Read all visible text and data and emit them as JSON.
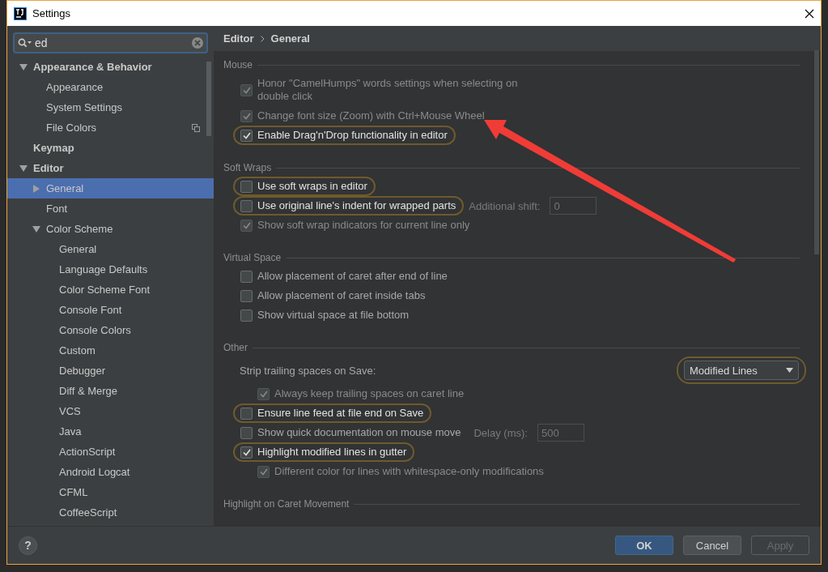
{
  "window": {
    "title": "Settings"
  },
  "sidebar": {
    "search": {
      "value": "ed"
    },
    "items": [
      {
        "label": "Appearance & Behavior",
        "expanded": true,
        "selected": false,
        "children": [
          {
            "label": "Appearance",
            "selected": false
          },
          {
            "label": "System Settings",
            "selected": false
          },
          {
            "label": "File Colors",
            "selected": false,
            "project_level": true
          }
        ]
      },
      {
        "label": "Keymap",
        "selected": false
      },
      {
        "label": "Editor",
        "expanded": true,
        "selected": false,
        "children": [
          {
            "label": "General",
            "expanded": false,
            "selected": true
          },
          {
            "label": "Font",
            "selected": false
          },
          {
            "label": "Color Scheme",
            "expanded": true,
            "selected": false,
            "children": [
              {
                "label": "General",
                "selected": false
              },
              {
                "label": "Language Defaults",
                "selected": false
              },
              {
                "label": "Color Scheme Font",
                "selected": false
              },
              {
                "label": "Console Font",
                "selected": false
              },
              {
                "label": "Console Colors",
                "selected": false
              },
              {
                "label": "Custom",
                "selected": false
              },
              {
                "label": "Debugger",
                "selected": false
              },
              {
                "label": "Diff & Merge",
                "selected": false
              },
              {
                "label": "VCS",
                "selected": false
              },
              {
                "label": "Java",
                "selected": false
              },
              {
                "label": "ActionScript",
                "selected": false
              },
              {
                "label": "Android Logcat",
                "selected": false
              },
              {
                "label": "CFML",
                "selected": false
              },
              {
                "label": "CoffeeScript",
                "selected": false
              }
            ]
          }
        ]
      }
    ]
  },
  "breadcrumb": [
    "Editor",
    "General"
  ],
  "sections": [
    {
      "title": "Mouse",
      "rows": [
        {
          "kind": "checkbox",
          "label": "Honor \"CamelHumps\" words settings when selecting on double click",
          "checked": true,
          "disabled": true,
          "highlighted": false
        },
        {
          "kind": "checkbox",
          "label": "Change font size (Zoom) with Ctrl+Mouse Wheel",
          "checked": true,
          "disabled": true,
          "highlighted": false
        },
        {
          "kind": "checkbox",
          "label": "Enable Drag'n'Drop functionality in editor",
          "checked": true,
          "disabled": false,
          "highlighted": true
        }
      ]
    },
    {
      "title": "Soft Wraps",
      "rows": [
        {
          "kind": "checkbox",
          "label": "Use soft wraps in editor",
          "checked": false,
          "disabled": false,
          "highlighted": true
        },
        {
          "kind": "checkbox",
          "label": "Use original line's indent for wrapped parts",
          "checked": false,
          "disabled": false,
          "highlighted": true,
          "field": {
            "label": "Additional shift:",
            "value": "0",
            "disabled": true
          }
        },
        {
          "kind": "checkbox",
          "label": "Show soft wrap indicators for current line only",
          "checked": true,
          "disabled": true,
          "highlighted": false
        }
      ]
    },
    {
      "title": "Virtual Space",
      "rows": [
        {
          "kind": "checkbox",
          "label": "Allow placement of caret after end of line",
          "checked": false,
          "disabled": false,
          "highlighted": false
        },
        {
          "kind": "checkbox",
          "label": "Allow placement of caret inside tabs",
          "checked": false,
          "disabled": false,
          "highlighted": false
        },
        {
          "kind": "checkbox",
          "label": "Show virtual space at file bottom",
          "checked": false,
          "disabled": false,
          "highlighted": false
        }
      ]
    },
    {
      "title": "Other",
      "rows": [
        {
          "kind": "dropdown",
          "label": "Strip trailing spaces on Save:",
          "value": "Modified Lines",
          "highlighted": true,
          "children": [
            {
              "kind": "checkbox",
              "label": "Always keep trailing spaces on caret line",
              "checked": true,
              "disabled": true,
              "highlighted": false
            }
          ]
        },
        {
          "kind": "checkbox",
          "label": "Ensure line feed at file end on Save",
          "checked": false,
          "disabled": false,
          "highlighted": true
        },
        {
          "kind": "checkbox",
          "label": "Show quick documentation on mouse move",
          "checked": false,
          "disabled": false,
          "highlighted": false,
          "field": {
            "label": "Delay (ms):",
            "value": "500",
            "disabled": true
          }
        },
        {
          "kind": "checkbox",
          "label": "Highlight modified lines in gutter",
          "checked": true,
          "disabled": false,
          "highlighted": true,
          "children": [
            {
              "kind": "checkbox",
              "label": "Different color for lines with whitespace-only modifications",
              "checked": true,
              "disabled": true,
              "highlighted": false
            }
          ]
        }
      ]
    },
    {
      "title": "Highlight on Caret Movement"
    }
  ],
  "footer": {
    "help": "?",
    "buttons": [
      {
        "label": "OK",
        "default": true,
        "disabled": false
      },
      {
        "label": "Cancel",
        "default": false,
        "disabled": false
      },
      {
        "label": "Apply",
        "default": false,
        "disabled": true
      }
    ]
  }
}
